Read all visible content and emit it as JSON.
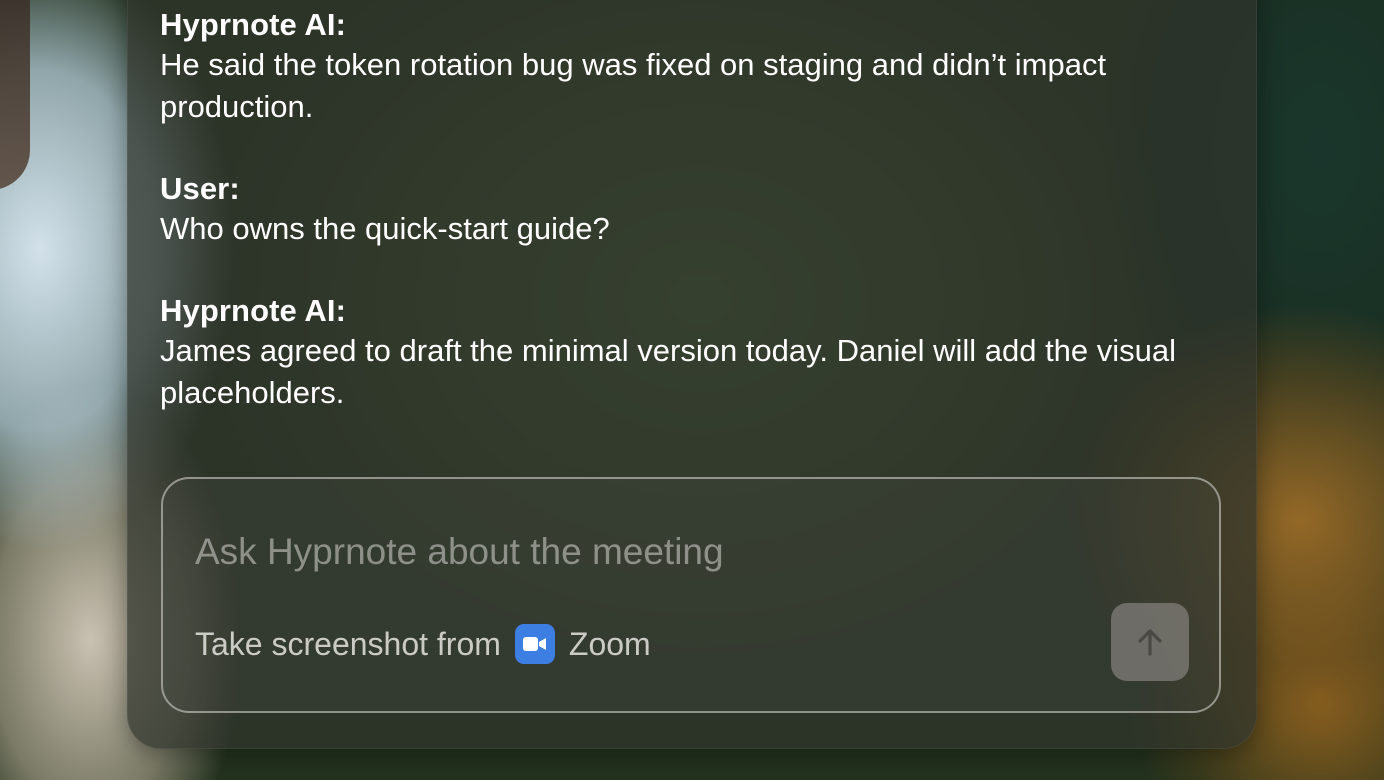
{
  "conversation": [
    {
      "speaker": "Hyprnote AI:",
      "text": "He said the token rotation bug was fixed on staging and didn’t impact production."
    },
    {
      "speaker": "User:",
      "text": "Who owns the quick-start guide?"
    },
    {
      "speaker": "Hyprnote AI:",
      "text": "James agreed to draft the minimal version today. Daniel will add the visual placeholders."
    }
  ],
  "composer": {
    "placeholder": "Ask Hyprnote about the meeting",
    "screenshot_label": "Take screenshot from",
    "app_name": "Zoom",
    "app_icon": "zoom-video-camera-icon",
    "send_icon": "arrow-up-icon"
  },
  "colors": {
    "zoom_blue": "#3d7ee3",
    "panel_bg": "#30342c",
    "send_button": "#78766f"
  }
}
